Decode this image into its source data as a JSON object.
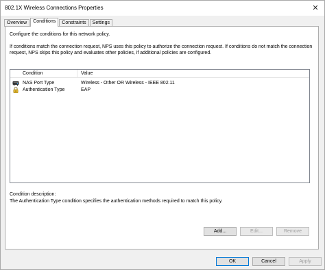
{
  "window": {
    "title": "802.1X Wireless Connections Properties",
    "close_glyph": "✕"
  },
  "tabs": [
    {
      "label": "Overview"
    },
    {
      "label": "Conditions"
    },
    {
      "label": "Constraints"
    },
    {
      "label": "Settings"
    }
  ],
  "active_tab": "Conditions",
  "panel": {
    "intro": "Configure the conditions for this network policy.",
    "explanation": "If conditions match the connection request, NPS uses this policy to authorize the connection request. If conditions do not match the connection request, NPS skips this policy and evaluates other policies, if additional policies are configured.",
    "table": {
      "headers": {
        "condition": "Condition",
        "value": "Value"
      },
      "rows": [
        {
          "icon": "network-device-icon",
          "condition": "NAS Port Type",
          "value": "Wireless - Other OR Wireless - IEEE 802.11"
        },
        {
          "icon": "lock-icon",
          "condition": "Authentication Type",
          "value": "EAP"
        }
      ]
    },
    "description_label": "Condition description:",
    "description_text": "The Authentication Type condition specifies the authentication methods required to match this policy.",
    "buttons": {
      "add": "Add...",
      "edit": "Edit...",
      "remove": "Remove"
    }
  },
  "footer": {
    "ok": "OK",
    "cancel": "Cancel",
    "apply": "Apply"
  },
  "colors": {
    "focus_border": "#0078d7",
    "disabled_text": "#a0a0a0"
  }
}
